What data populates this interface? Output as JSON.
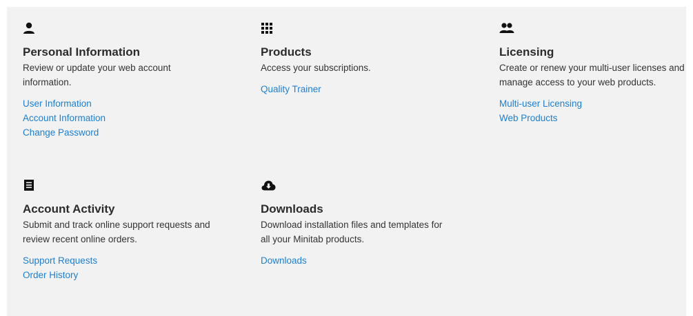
{
  "cards": {
    "personal": {
      "icon": "person-icon",
      "title": "Personal Information",
      "description": "Review or update your web account information.",
      "links": [
        "User Information",
        "Account Information",
        "Change Password"
      ]
    },
    "products": {
      "icon": "grid-icon",
      "title": "Products",
      "description": "Access your subscriptions.",
      "links": [
        "Quality Trainer"
      ]
    },
    "licensing": {
      "icon": "people-icon",
      "title": "Licensing",
      "description": "Create or renew your multi-user licenses and manage access to your web products.",
      "links": [
        "Multi-user Licensing",
        "Web Products"
      ]
    },
    "activity": {
      "icon": "receipt-icon",
      "title": "Account Activity",
      "description": "Submit and track online support requests and review recent online orders.",
      "links": [
        "Support Requests",
        "Order History"
      ]
    },
    "downloads": {
      "icon": "cloud-download-icon",
      "title": "Downloads",
      "description": "Download installation files and templates for all your Minitab products.",
      "links": [
        "Downloads"
      ]
    }
  },
  "colors": {
    "panel_background": "#f2f2f2",
    "link": "#1d7fd1",
    "title": "#2b2b2b",
    "icon": "#111111"
  }
}
